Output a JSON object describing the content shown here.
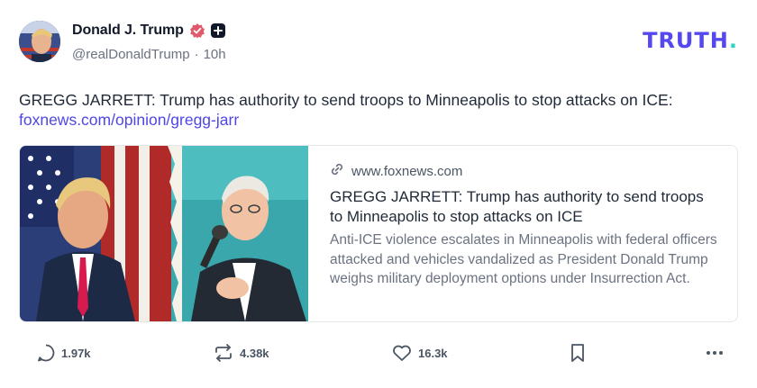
{
  "post": {
    "author": {
      "display_name": "Donald J. Trump",
      "handle": "@realDonaldTrump",
      "separator": "·",
      "time": "10h"
    },
    "brand": {
      "logo_text": "TRUTH",
      "logo_dot": "."
    },
    "text": "GREGG JARRETT: Trump has authority to send troops to Minneapolis to stop attacks on ICE:",
    "link_text": "foxnews.com/opinion/gregg-jarr",
    "card": {
      "domain": "www.foxnews.com",
      "title": "GREGG JARRETT: Trump has authority to send troops to Minneapolis to stop attacks on ICE",
      "description": "Anti-ICE violence escalates in Minneapolis with federal officers attacked and vehicles vandalized as President Donald Trump weighs military deployment options under Insurrection Act."
    },
    "actions": {
      "replies": "1.97k",
      "retruths": "4.38k",
      "likes": "16.3k"
    }
  },
  "colors": {
    "brand_purple": "#5448ee",
    "brand_teal": "#2dd4bf",
    "link": "#4f46e5",
    "verified": "#e05a6d",
    "muted_text": "#6b7280"
  },
  "icons": [
    "verified-badge-icon",
    "plus-badge-icon",
    "link-icon",
    "reply-icon",
    "retruth-icon",
    "like-icon",
    "bookmark-icon",
    "more-icon"
  ]
}
